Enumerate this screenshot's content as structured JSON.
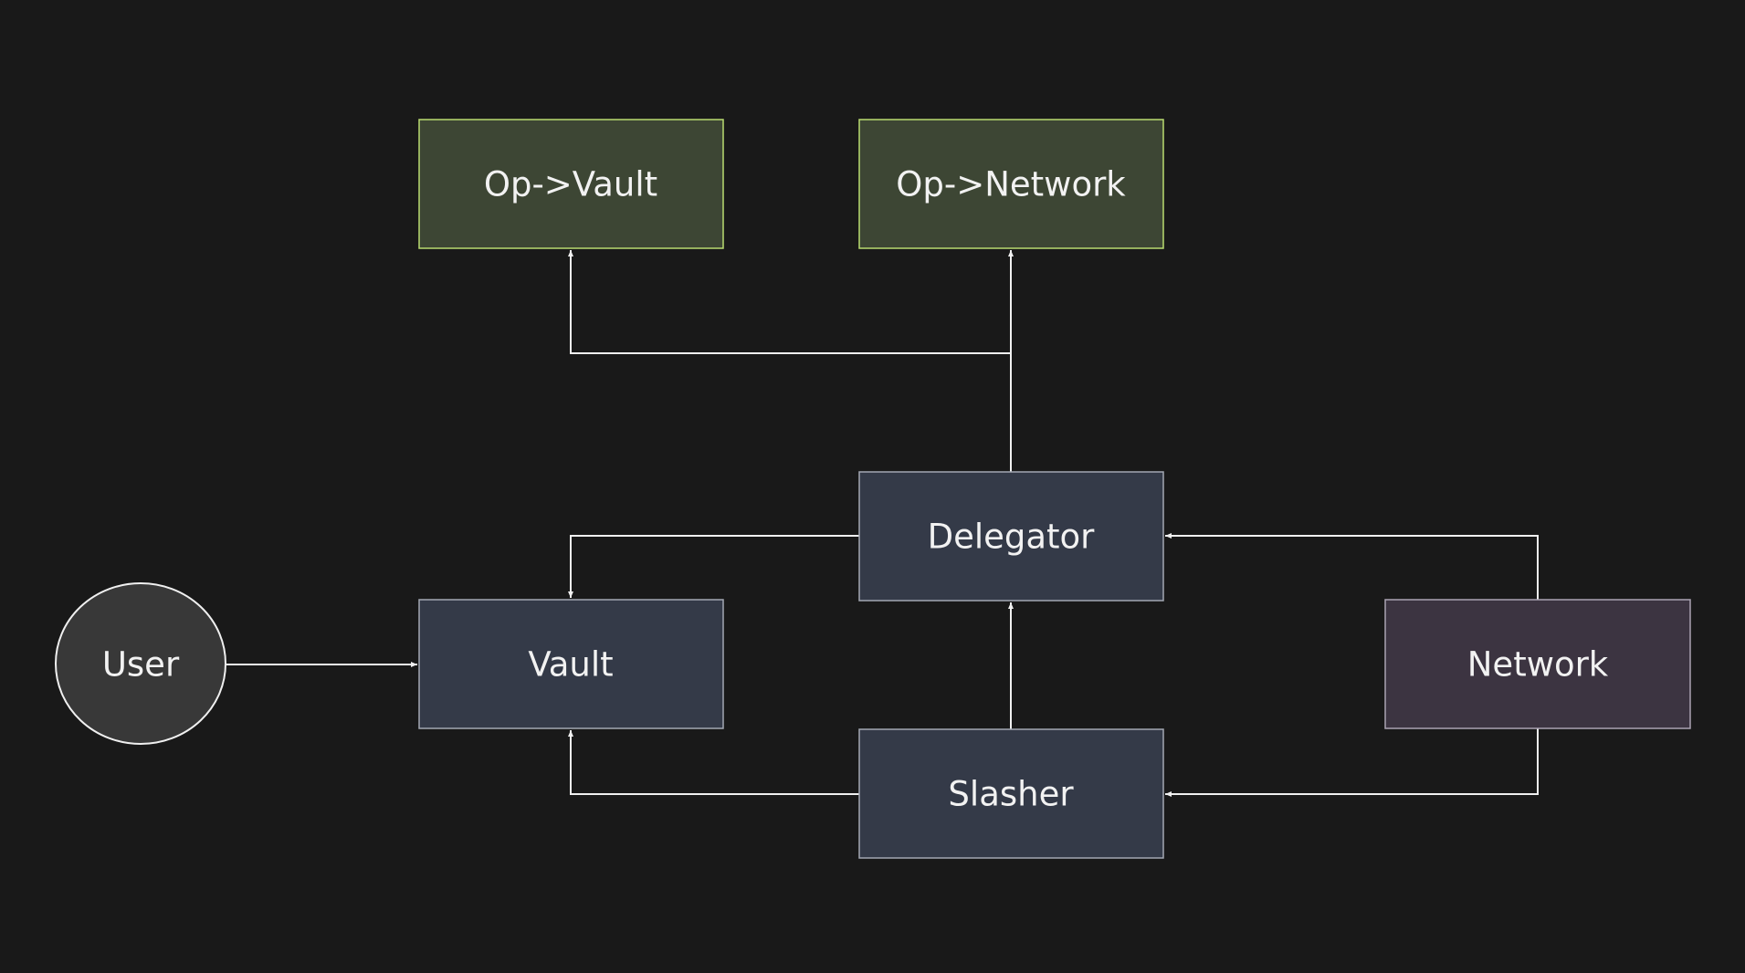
{
  "colors": {
    "background": "#191919",
    "operator_fill": "#3d4634",
    "operator_border": "#b9dc70",
    "core_fill": "#343a48",
    "core_border": "#a3a7b3",
    "network_fill": "#3c3441",
    "network_border": "#aaa3b3",
    "user_fill": "#383838",
    "edge": "#f0f0f0"
  },
  "nodes": {
    "op_vault": {
      "label": "Op->Vault"
    },
    "op_network": {
      "label": "Op->Network"
    },
    "delegator": {
      "label": "Delegator"
    },
    "vault": {
      "label": "Vault"
    },
    "slasher": {
      "label": "Slasher"
    },
    "network": {
      "label": "Network"
    },
    "user": {
      "label": "User",
      "shape": "circle"
    }
  },
  "edges": [
    {
      "from": "delegator",
      "to": "op_vault"
    },
    {
      "from": "delegator",
      "to": "op_network"
    },
    {
      "from": "delegator",
      "to": "vault"
    },
    {
      "from": "network",
      "to": "delegator"
    },
    {
      "from": "slasher",
      "to": "delegator"
    },
    {
      "from": "slasher",
      "to": "vault"
    },
    {
      "from": "network",
      "to": "slasher"
    },
    {
      "from": "user",
      "to": "vault"
    }
  ]
}
